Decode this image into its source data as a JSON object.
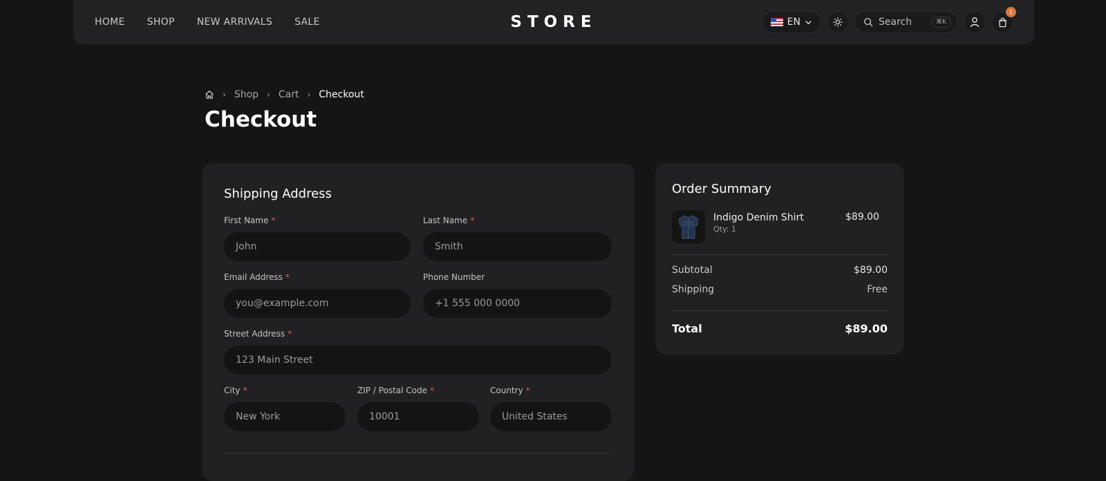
{
  "nav": {
    "links": [
      "HOME",
      "SHOP",
      "NEW ARRIVALS",
      "SALE"
    ],
    "logo": "STORE",
    "language": "EN",
    "search_placeholder": "Search",
    "search_shortcut": "⌘K",
    "cart_count": "1"
  },
  "breadcrumb": {
    "items": [
      "Shop",
      "Cart"
    ],
    "current": "Checkout"
  },
  "page_title": "Checkout",
  "shipping": {
    "title": "Shipping Address",
    "first_name": {
      "label": "First Name",
      "placeholder": "John"
    },
    "last_name": {
      "label": "Last Name",
      "placeholder": "Smith"
    },
    "email": {
      "label": "Email Address",
      "placeholder": "you@example.com"
    },
    "phone": {
      "label": "Phone Number",
      "placeholder": "+1 555 000 0000"
    },
    "street": {
      "label": "Street Address",
      "placeholder": "123 Main Street"
    },
    "city": {
      "label": "City",
      "placeholder": "New York"
    },
    "zip": {
      "label": "ZIP / Postal Code",
      "placeholder": "10001"
    },
    "country": {
      "label": "Country",
      "placeholder": "United States"
    },
    "required_mark": "*"
  },
  "summary": {
    "title": "Order Summary",
    "item": {
      "name": "Indigo Denim Shirt",
      "qty": "Qty: 1",
      "price": "$89.00"
    },
    "subtotal_label": "Subtotal",
    "subtotal_value": "$89.00",
    "shipping_label": "Shipping",
    "shipping_value": "Free",
    "total_label": "Total",
    "total_value": "$89.00"
  },
  "colors": {
    "badge": "#d9783f",
    "required": "#e05a5a",
    "background": "#151515",
    "card": "#212123"
  }
}
